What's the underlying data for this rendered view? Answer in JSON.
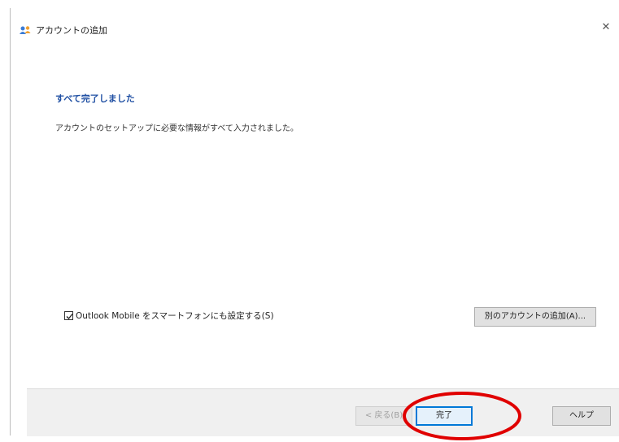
{
  "window": {
    "title": "アカウントの追加",
    "close_glyph": "✕"
  },
  "content": {
    "heading": "すべて完了しました",
    "message": "アカウントのセットアップに必要な情報がすべて入力されました。"
  },
  "options": {
    "mobile_checkbox_label": "Outlook Mobile をスマートフォンにも設定する(S)",
    "mobile_checkbox_checked": true
  },
  "buttons": {
    "add_another": "別のアカウントの追加(A)...",
    "back": "< 戻る(B)",
    "finish": "完了",
    "help": "ヘルプ"
  },
  "colors": {
    "heading": "#1f4fa3",
    "highlight": "#e00000",
    "default_button_border": "#0078d7"
  },
  "icons": {
    "app": "account-add-icon",
    "close": "close-icon",
    "check": "checkmark-icon"
  }
}
